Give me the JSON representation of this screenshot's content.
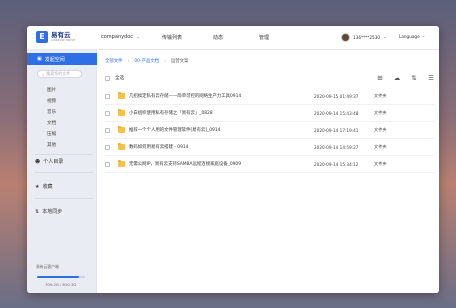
{
  "header": {
    "logo_mark": "E",
    "logo_name": "易有云",
    "logo_sub": "LINKEASE DRIVE",
    "company": "companydoc",
    "nav": [
      "传输列表",
      "动态",
      "管理"
    ],
    "user": "136****2530",
    "language": "Language"
  },
  "sidebar": {
    "active": "发起空间",
    "search_placeholder": "搜索您的文件",
    "sub_items": [
      "图片",
      "视频",
      "音乐",
      "文档",
      "压缩",
      "其他"
    ],
    "personal": "个人目录",
    "favorites": "收藏",
    "local_sync": "本地同步",
    "quota_label": "易有云客户端",
    "quota_text": "709.2G / 810.3G",
    "quota_fraction": 0.875
  },
  "main": {
    "breadcrumb": [
      "全部文件",
      "00-产品文档",
      "运营文案"
    ],
    "select_all": "全选",
    "rows": [
      {
        "name": "几招搞定私有云存储——简单可控的网络生产力工具0914",
        "date": "2020-09-15 01:49:37",
        "type": "文件夹"
      },
      {
        "name": "小白组织使用私有存储之「易有云」_0828",
        "date": "2020-09-14 15:43:48",
        "type": "文件夹"
      },
      {
        "name": "推荐一个个人用的文件管理软件[易有云]_0914",
        "date": "2020-09-14 17:19:41",
        "type": "文件夹"
      },
      {
        "name": "数码如何用易有云搭建 - 0914",
        "date": "2020-09-14 14:59:27",
        "type": "文件夹"
      },
      {
        "name": "无需公网IP，易有云支持SAMBA远程连接家庭设备_0909",
        "date": "2020-09-14 15:34:12",
        "type": "文件夹"
      }
    ]
  }
}
